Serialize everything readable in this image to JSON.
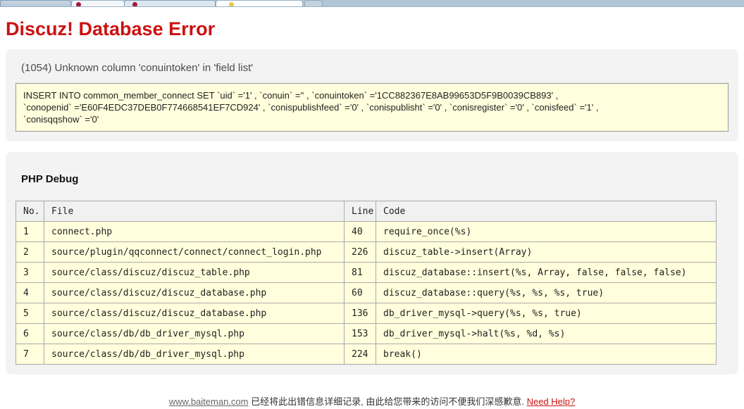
{
  "browser": {
    "tabs": [
      {
        "label": "",
        "state": "inactive",
        "favicon": null,
        "favicon_name": null
      },
      {
        "label": "",
        "state": "active",
        "favicon": "#a1193d",
        "favicon_name": "red-site-favicon"
      },
      {
        "label": "",
        "state": "inactive",
        "favicon": "#a1193d",
        "favicon_name": "red-site-favicon"
      },
      {
        "label": "",
        "state": "inactive",
        "favicon": "#e8c84d",
        "favicon_name": "yellow-site-favicon"
      }
    ]
  },
  "page": {
    "title": "Discuz! Database Error",
    "error": {
      "message": "(1054) Unknown column 'conuintoken' in 'field list'",
      "sql": "INSERT INTO common_member_connect SET `uid` ='1' , `conuin` ='' , `conuintoken` ='1CC882367E8AB99653D5F9B0039CB893' ,\n`conopenid` ='E60F4EDC37DEB0F774668541EF7CD924' , `conispublishfeed` ='0' , `conispublisht` ='0' , `conisregister` ='0' , `conisfeed` ='1' ,\n`conisqqshow` ='0'"
    },
    "debug": {
      "heading": "PHP Debug",
      "table": {
        "headers": [
          "No.",
          "File",
          "Line",
          "Code"
        ],
        "rows": [
          [
            "1",
            "connect.php",
            "40",
            "require_once(%s)"
          ],
          [
            "2",
            "source/plugin/qqconnect/connect/connect_login.php",
            "226",
            "discuz_table->insert(Array)"
          ],
          [
            "3",
            "source/class/discuz/discuz_table.php",
            "81",
            "discuz_database::insert(%s, Array, false, false, false)"
          ],
          [
            "4",
            "source/class/discuz/discuz_database.php",
            "60",
            "discuz_database::query(%s, %s, %s, true)"
          ],
          [
            "5",
            "source/class/discuz/discuz_database.php",
            "136",
            "db_driver_mysql->query(%s, %s, true)"
          ],
          [
            "6",
            "source/class/db/db_driver_mysql.php",
            "153",
            "db_driver_mysql->halt(%s, %d, %s)"
          ],
          [
            "7",
            "source/class/db/db_driver_mysql.php",
            "224",
            "break()"
          ]
        ]
      }
    },
    "footer": {
      "site_link": "www.baiteman.com",
      "message": "已经将此出错信息详细记录, 由此给您带来的访问不便我们深感歉意.",
      "help_link": "Need Help?"
    },
    "colors": {
      "accent_red": "#cc1111",
      "sql_box_bg": "#ffffdd",
      "sql_box_border": "#999999",
      "panel_bg": "#f3f3f3",
      "table_cell_bg": "#ffffdd",
      "table_header_bg": "#f1f1f1",
      "table_border": "#aaaaaa",
      "tabbar_bg": "#b2c5d5",
      "link_gray": "#666666"
    }
  }
}
